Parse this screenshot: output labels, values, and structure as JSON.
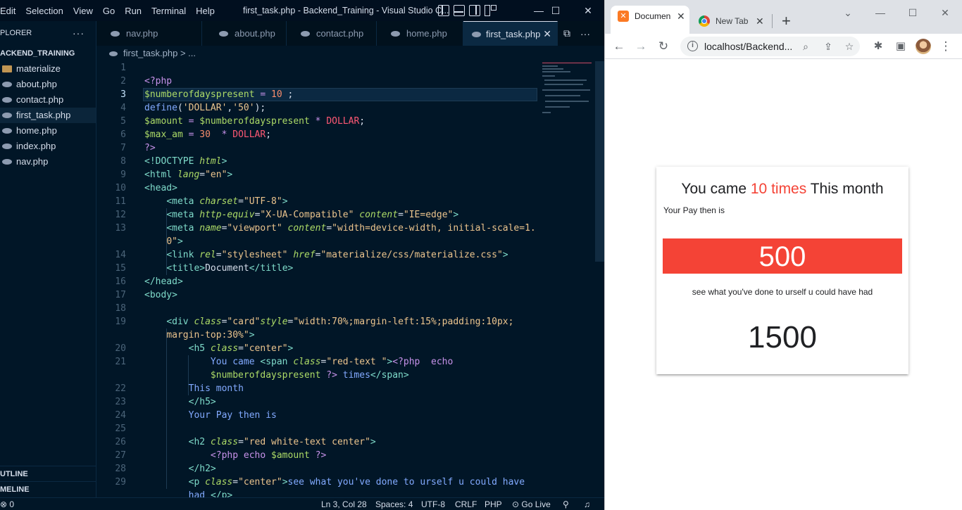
{
  "vscode": {
    "menu": [
      "Edit",
      "Selection",
      "View",
      "Go",
      "Run",
      "Terminal",
      "Help"
    ],
    "window_title": "first_task.php - Backend_Training - Visual Studio C...",
    "window_controls": {
      "minimize": "—",
      "maximize": "☐",
      "close": "✕"
    },
    "explorer": {
      "header": "PLORER",
      "more": "···",
      "folder": "ACKEND_TRAINING",
      "items": [
        {
          "label": "materialize",
          "kind": "folder"
        },
        {
          "label": "about.php",
          "kind": "php"
        },
        {
          "label": "contact.php",
          "kind": "php"
        },
        {
          "label": "first_task.php",
          "kind": "php",
          "active": true
        },
        {
          "label": "home.php",
          "kind": "php"
        },
        {
          "label": "index.php",
          "kind": "php"
        },
        {
          "label": "nav.php",
          "kind": "php"
        }
      ],
      "outline": "UTLINE",
      "timeline": "MELINE"
    },
    "tabs": [
      {
        "label": "nav.php"
      },
      {
        "label": "about.php"
      },
      {
        "label": "contact.php"
      },
      {
        "label": "home.php"
      },
      {
        "label": "first_task.php",
        "active": true
      }
    ],
    "tab_close": "✕",
    "tab_actions": {
      "split": "⧉",
      "more": "···"
    },
    "breadcrumb": {
      "file": "first_task.php",
      "sep": ">",
      "rest": "..."
    },
    "status": {
      "left": "⊗ 0",
      "position": "Ln 3, Col 28",
      "spaces": "Spaces: 4",
      "encoding": "UTF-8",
      "eol": "CRLF",
      "language": "PHP",
      "golive": "Go Live"
    }
  },
  "code_lines": [
    {
      "n": "1",
      "tokens": []
    },
    {
      "n": "2",
      "tokens": [
        [
          "kw",
          "<?php"
        ]
      ]
    },
    {
      "n": "3",
      "tokens": [
        [
          "var",
          "$numberofdayspresent"
        ],
        [
          "op",
          " = "
        ],
        [
          "num",
          "10"
        ],
        [
          "txt",
          " ;"
        ]
      ]
    },
    {
      "n": "4",
      "tokens": [
        [
          "fn",
          "define"
        ],
        [
          "txt",
          "("
        ],
        [
          "str",
          "'DOLLAR'"
        ],
        [
          "txt",
          ","
        ],
        [
          "str",
          "'50'"
        ],
        [
          "txt",
          ");"
        ]
      ]
    },
    {
      "n": "5",
      "tokens": [
        [
          "var",
          "$amount"
        ],
        [
          "op",
          " = "
        ],
        [
          "var",
          "$numberofdayspresent"
        ],
        [
          "op",
          " * "
        ],
        [
          "const",
          "DOLLAR"
        ],
        [
          "txt",
          ";"
        ]
      ]
    },
    {
      "n": "6",
      "tokens": [
        [
          "var",
          "$max_am"
        ],
        [
          "op",
          " = "
        ],
        [
          "num",
          "30"
        ],
        [
          "op",
          "  * "
        ],
        [
          "const",
          "DOLLAR"
        ],
        [
          "txt",
          ";"
        ]
      ]
    },
    {
      "n": "7",
      "tokens": [
        [
          "kw",
          "?>"
        ]
      ]
    },
    {
      "n": "8",
      "tokens": [
        [
          "tag",
          "<!DOCTYPE "
        ],
        [
          "attr",
          "html"
        ],
        [
          "tag",
          ">"
        ]
      ]
    },
    {
      "n": "9",
      "tokens": [
        [
          "tag",
          "<html "
        ],
        [
          "attr",
          "lang"
        ],
        [
          "txt",
          "="
        ],
        [
          "str",
          "\"en\""
        ],
        [
          "tag",
          ">"
        ]
      ]
    },
    {
      "n": "10",
      "tokens": [
        [
          "tag",
          "<head>"
        ]
      ]
    },
    {
      "n": "11",
      "tokens": [
        [
          "txt",
          "    "
        ],
        [
          "tag",
          "<meta "
        ],
        [
          "attr",
          "charset"
        ],
        [
          "txt",
          "="
        ],
        [
          "str",
          "\"UTF-8\""
        ],
        [
          "tag",
          ">"
        ]
      ]
    },
    {
      "n": "12",
      "tokens": [
        [
          "txt",
          "    "
        ],
        [
          "tag",
          "<meta "
        ],
        [
          "attr",
          "http-equiv"
        ],
        [
          "txt",
          "="
        ],
        [
          "str",
          "\"X-UA-Compatible\""
        ],
        [
          "txt",
          " "
        ],
        [
          "attr",
          "content"
        ],
        [
          "txt",
          "="
        ],
        [
          "str",
          "\"IE=edge\""
        ],
        [
          "tag",
          ">"
        ]
      ]
    },
    {
      "n": "13",
      "tokens": [
        [
          "txt",
          "    "
        ],
        [
          "tag",
          "<meta "
        ],
        [
          "attr",
          "name"
        ],
        [
          "txt",
          "="
        ],
        [
          "str",
          "\"viewport\""
        ],
        [
          "txt",
          " "
        ],
        [
          "attr",
          "content"
        ],
        [
          "txt",
          "="
        ],
        [
          "str",
          "\"width=device-width, initial-scale=1."
        ]
      ]
    },
    {
      "n": "",
      "tokens": [
        [
          "txt",
          "    "
        ],
        [
          "str",
          "0\""
        ],
        [
          "tag",
          ">"
        ]
      ]
    },
    {
      "n": "14",
      "tokens": [
        [
          "txt",
          "    "
        ],
        [
          "tag",
          "<link "
        ],
        [
          "attr",
          "rel"
        ],
        [
          "txt",
          "="
        ],
        [
          "str",
          "\"stylesheet\""
        ],
        [
          "txt",
          " "
        ],
        [
          "attr",
          "href"
        ],
        [
          "txt",
          "="
        ],
        [
          "str",
          "\"materialize/css/materialize.css\""
        ],
        [
          "tag",
          ">"
        ]
      ]
    },
    {
      "n": "15",
      "tokens": [
        [
          "txt",
          "    "
        ],
        [
          "tag",
          "<title>"
        ],
        [
          "txt",
          "Document"
        ],
        [
          "tag",
          "</title>"
        ]
      ]
    },
    {
      "n": "16",
      "tokens": [
        [
          "tag",
          "</head>"
        ]
      ]
    },
    {
      "n": "17",
      "tokens": [
        [
          "tag",
          "<body>"
        ]
      ]
    },
    {
      "n": "18",
      "tokens": []
    },
    {
      "n": "19",
      "tokens": [
        [
          "txt",
          "    "
        ],
        [
          "tag",
          "<div "
        ],
        [
          "attr",
          "class"
        ],
        [
          "txt",
          "="
        ],
        [
          "str",
          "\"card\""
        ],
        [
          "attr",
          "style"
        ],
        [
          "txt",
          "="
        ],
        [
          "str",
          "\"width:70%;margin-left:15%;padding:10px;"
        ]
      ]
    },
    {
      "n": "",
      "tokens": [
        [
          "txt",
          "    "
        ],
        [
          "str",
          "margin-top:30%\""
        ],
        [
          "tag",
          ">"
        ]
      ]
    },
    {
      "n": "20",
      "tokens": [
        [
          "txt",
          "        "
        ],
        [
          "tag",
          "<h5 "
        ],
        [
          "attr",
          "class"
        ],
        [
          "txt",
          "="
        ],
        [
          "str",
          "\"center\""
        ],
        [
          "tag",
          ">"
        ]
      ]
    },
    {
      "n": "21",
      "tokens": [
        [
          "txt",
          "            "
        ],
        [
          "fn",
          "You came "
        ],
        [
          "tag",
          "<span "
        ],
        [
          "attr",
          "class"
        ],
        [
          "txt",
          "="
        ],
        [
          "str",
          "\"red-text \""
        ],
        [
          "tag",
          ">"
        ],
        [
          "kw",
          "<?php"
        ],
        [
          "txt",
          "  "
        ],
        [
          "kw",
          "echo"
        ]
      ]
    },
    {
      "n": "",
      "tokens": [
        [
          "txt",
          "            "
        ],
        [
          "var",
          "$numberofdayspresent"
        ],
        [
          "txt",
          " "
        ],
        [
          "kw",
          "?>"
        ],
        [
          "fn",
          " times"
        ],
        [
          "tag",
          "</span>"
        ]
      ]
    },
    {
      "n": "22",
      "tokens": [
        [
          "txt",
          "        "
        ],
        [
          "fn",
          "This month"
        ]
      ]
    },
    {
      "n": "23",
      "tokens": [
        [
          "txt",
          "        "
        ],
        [
          "tag",
          "</h5>"
        ]
      ]
    },
    {
      "n": "24",
      "tokens": [
        [
          "txt",
          "        "
        ],
        [
          "fn",
          "Your Pay then is"
        ]
      ]
    },
    {
      "n": "25",
      "tokens": []
    },
    {
      "n": "26",
      "tokens": [
        [
          "txt",
          "        "
        ],
        [
          "tag",
          "<h2 "
        ],
        [
          "attr",
          "class"
        ],
        [
          "txt",
          "="
        ],
        [
          "str",
          "\"red white-text center\""
        ],
        [
          "tag",
          ">"
        ]
      ]
    },
    {
      "n": "27",
      "tokens": [
        [
          "txt",
          "            "
        ],
        [
          "kw",
          "<?php"
        ],
        [
          "kw",
          " echo "
        ],
        [
          "var",
          "$amount"
        ],
        [
          "kw",
          " ?>"
        ]
      ]
    },
    {
      "n": "28",
      "tokens": [
        [
          "txt",
          "        "
        ],
        [
          "tag",
          "</h2>"
        ]
      ]
    },
    {
      "n": "29",
      "tokens": [
        [
          "txt",
          "        "
        ],
        [
          "tag",
          "<p "
        ],
        [
          "attr",
          "class"
        ],
        [
          "txt",
          "="
        ],
        [
          "str",
          "\"center\""
        ],
        [
          "tag",
          ">"
        ],
        [
          "fn",
          "see what you've done to urself u could have"
        ]
      ]
    },
    {
      "n": "",
      "tokens": [
        [
          "txt",
          "        "
        ],
        [
          "fn",
          "had "
        ],
        [
          "tag",
          "</p>"
        ]
      ]
    }
  ],
  "chrome": {
    "tabs": [
      {
        "title": "Documen",
        "active": true
      },
      {
        "title": "New Tab"
      }
    ],
    "tab_close": "✕",
    "new_tab": "+",
    "window_controls": {
      "dropdown": "⌄",
      "minimize": "—",
      "maximize": "☐",
      "close": "✕"
    },
    "nav": {
      "back": "←",
      "forward": "→",
      "reload": "↻"
    },
    "url": "localhost/Backend...",
    "info": "i",
    "omni_tools": {
      "zoom": "⌕",
      "share": "⇪",
      "star": "☆"
    },
    "toolbar_right": {
      "extensions": "✱",
      "sidepanel": "▣",
      "menu": "⋮"
    }
  },
  "page": {
    "heading_pre": "You came ",
    "heading_count": "10 times",
    "heading_post": " This month",
    "pay_label": "Your Pay then is",
    "amount": "500",
    "note": "see what you've done to urself u could have had",
    "max_amount": "1500",
    "colors": {
      "accent": "#f44336"
    }
  }
}
